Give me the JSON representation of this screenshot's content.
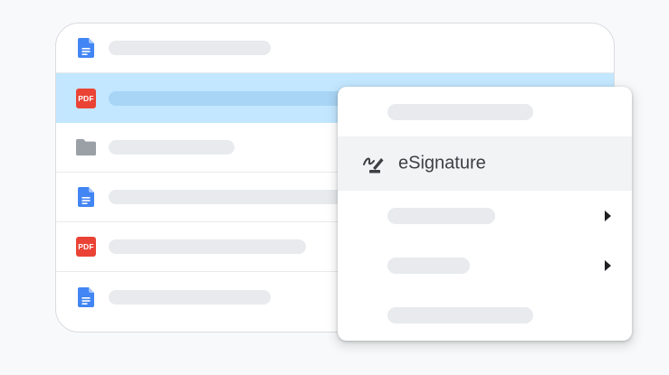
{
  "file_list": {
    "rows": [
      {
        "type": "doc",
        "selected": false
      },
      {
        "type": "pdf",
        "selected": true,
        "badge": "PDF"
      },
      {
        "type": "folder",
        "selected": false
      },
      {
        "type": "doc",
        "selected": false
      },
      {
        "type": "pdf",
        "selected": false,
        "badge": "PDF"
      },
      {
        "type": "doc",
        "selected": false
      }
    ]
  },
  "context_menu": {
    "items": [
      {
        "label": "",
        "icon": null,
        "submenu": false
      },
      {
        "label": "eSignature",
        "icon": "signature-pen-icon",
        "submenu": false,
        "highlighted": true
      },
      {
        "label": "",
        "icon": null,
        "submenu": true
      },
      {
        "label": "",
        "icon": null,
        "submenu": true
      },
      {
        "label": "",
        "icon": null,
        "submenu": false
      }
    ]
  },
  "colors": {
    "doc_blue": "#4285f4",
    "pdf_red": "#ea4335",
    "folder_gray": "#9aa0a6",
    "selected_row": "#c2e7ff",
    "menu_highlight": "#f1f3f4"
  }
}
